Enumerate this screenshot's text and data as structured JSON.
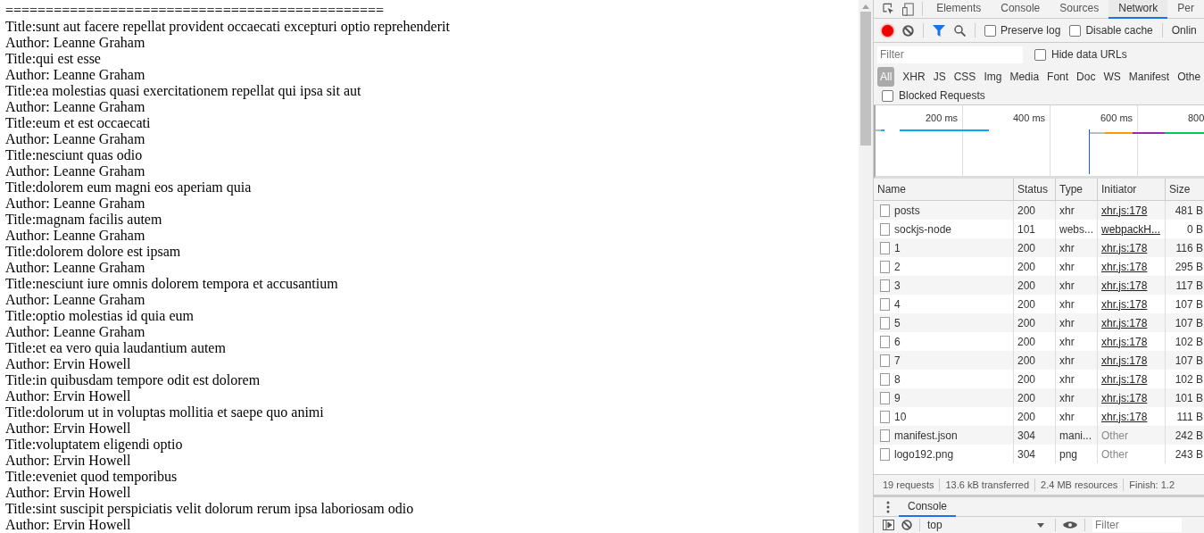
{
  "page": {
    "separator": "===============================================",
    "posts": [
      {
        "title": "Title:sunt aut facere repellat provident occaecati excepturi optio reprehenderit",
        "author": "Author: Leanne Graham"
      },
      {
        "title": "Title:qui est esse",
        "author": "Author: Leanne Graham"
      },
      {
        "title": "Title:ea molestias quasi exercitationem repellat qui ipsa sit aut",
        "author": "Author: Leanne Graham"
      },
      {
        "title": "Title:eum et est occaecati",
        "author": "Author: Leanne Graham"
      },
      {
        "title": "Title:nesciunt quas odio",
        "author": "Author: Leanne Graham"
      },
      {
        "title": "Title:dolorem eum magni eos aperiam quia",
        "author": "Author: Leanne Graham"
      },
      {
        "title": "Title:magnam facilis autem",
        "author": "Author: Leanne Graham"
      },
      {
        "title": "Title:dolorem dolore est ipsam",
        "author": "Author: Leanne Graham"
      },
      {
        "title": "Title:nesciunt iure omnis dolorem tempora et accusantium",
        "author": "Author: Leanne Graham"
      },
      {
        "title": "Title:optio molestias id quia eum",
        "author": "Author: Leanne Graham"
      },
      {
        "title": "Title:et ea vero quia laudantium autem",
        "author": "Author: Ervin Howell"
      },
      {
        "title": "Title:in quibusdam tempore odit est dolorem",
        "author": "Author: Ervin Howell"
      },
      {
        "title": "Title:dolorum ut in voluptas mollitia et saepe quo animi",
        "author": "Author: Ervin Howell"
      },
      {
        "title": "Title:voluptatem eligendi optio",
        "author": "Author: Ervin Howell"
      },
      {
        "title": "Title:eveniet quod temporibus",
        "author": "Author: Ervin Howell"
      },
      {
        "title": "Title:sint suscipit perspiciatis velit dolorum rerum ipsa laboriosam odio",
        "author": "Author: Ervin Howell"
      }
    ]
  },
  "devtools": {
    "tabs": [
      {
        "label": "Elements",
        "selected": false
      },
      {
        "label": "Console",
        "selected": false
      },
      {
        "label": "Sources",
        "selected": false
      },
      {
        "label": "Network",
        "selected": true
      },
      {
        "label": "Per",
        "selected": false
      }
    ],
    "toolbar": {
      "recording": true,
      "preserve_log": {
        "label": "Preserve log",
        "checked": false
      },
      "disable_cache": {
        "label": "Disable cache",
        "checked": false
      },
      "throttle": "Onlin"
    },
    "filter": {
      "placeholder": "Filter",
      "hide_data_urls": {
        "label": "Hide data URLs",
        "checked": false
      }
    },
    "types": [
      {
        "label": "All",
        "selected": true
      },
      {
        "label": "XHR",
        "selected": false
      },
      {
        "label": "JS",
        "selected": false
      },
      {
        "label": "CSS",
        "selected": false
      },
      {
        "label": "Img",
        "selected": false
      },
      {
        "label": "Media",
        "selected": false
      },
      {
        "label": "Font",
        "selected": false
      },
      {
        "label": "Doc",
        "selected": false
      },
      {
        "label": "WS",
        "selected": false
      },
      {
        "label": "Manifest",
        "selected": false
      },
      {
        "label": "Othe",
        "selected": false
      }
    ],
    "blocked_requests": {
      "label": "Blocked Requests",
      "checked": false
    },
    "timeline_ticks": [
      "200 ms",
      "400 ms",
      "600 ms",
      "800"
    ],
    "table": {
      "columns": [
        "Name",
        "Status",
        "Type",
        "Initiator",
        "Size"
      ],
      "rows": [
        {
          "name": "posts",
          "status": "200",
          "type": "xhr",
          "initiator": "xhr.js:178",
          "initiator_link": true,
          "size": "481 B"
        },
        {
          "name": "sockjs-node",
          "status": "101",
          "type": "webs...",
          "initiator": "webpackH...",
          "initiator_link": true,
          "size": "0 B"
        },
        {
          "name": "1",
          "status": "200",
          "type": "xhr",
          "initiator": "xhr.js:178",
          "initiator_link": true,
          "size": "116 B"
        },
        {
          "name": "2",
          "status": "200",
          "type": "xhr",
          "initiator": "xhr.js:178",
          "initiator_link": true,
          "size": "295 B"
        },
        {
          "name": "3",
          "status": "200",
          "type": "xhr",
          "initiator": "xhr.js:178",
          "initiator_link": true,
          "size": "117 B"
        },
        {
          "name": "4",
          "status": "200",
          "type": "xhr",
          "initiator": "xhr.js:178",
          "initiator_link": true,
          "size": "107 B"
        },
        {
          "name": "5",
          "status": "200",
          "type": "xhr",
          "initiator": "xhr.js:178",
          "initiator_link": true,
          "size": "107 B"
        },
        {
          "name": "6",
          "status": "200",
          "type": "xhr",
          "initiator": "xhr.js:178",
          "initiator_link": true,
          "size": "102 B"
        },
        {
          "name": "7",
          "status": "200",
          "type": "xhr",
          "initiator": "xhr.js:178",
          "initiator_link": true,
          "size": "107 B"
        },
        {
          "name": "8",
          "status": "200",
          "type": "xhr",
          "initiator": "xhr.js:178",
          "initiator_link": true,
          "size": "102 B"
        },
        {
          "name": "9",
          "status": "200",
          "type": "xhr",
          "initiator": "xhr.js:178",
          "initiator_link": true,
          "size": "101 B"
        },
        {
          "name": "10",
          "status": "200",
          "type": "xhr",
          "initiator": "xhr.js:178",
          "initiator_link": true,
          "size": "111 B"
        },
        {
          "name": "manifest.json",
          "status": "304",
          "type": "mani...",
          "initiator": "Other",
          "initiator_link": false,
          "size": "242 B"
        },
        {
          "name": "logo192.png",
          "status": "304",
          "type": "png",
          "initiator": "Other",
          "initiator_link": false,
          "size": "243 B"
        }
      ]
    },
    "summary": [
      "19 requests",
      "13.6 kB transferred",
      "2.4 MB resources",
      "Finish: 1.2"
    ],
    "drawer": {
      "tabs": [
        {
          "label": "Console",
          "selected": true
        }
      ],
      "context": "top",
      "filter_placeholder": "Filter"
    }
  }
}
